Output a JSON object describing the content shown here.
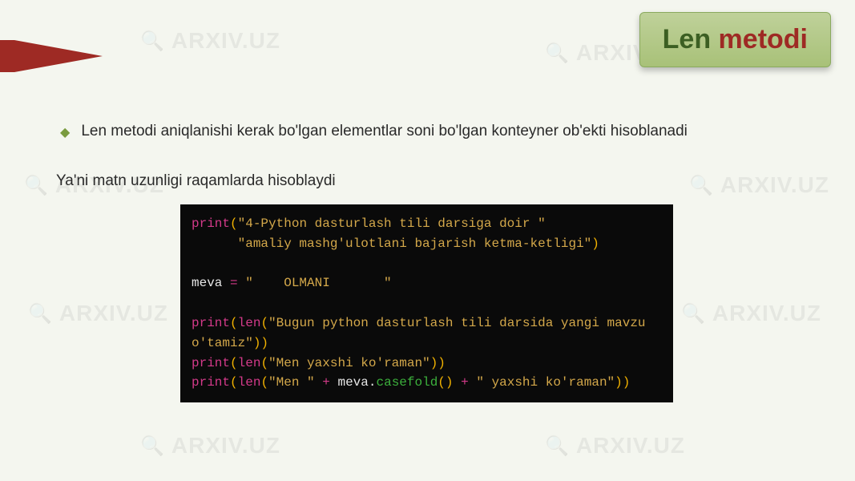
{
  "watermark_text": "ARXIV.UZ",
  "title": {
    "word1": "Len",
    "word2": "metodi"
  },
  "bullet": {
    "text": "Len metodi  aniqlanishi kerak bo'lgan elementlar soni bo'lgan konteyner ob'ekti hisoblanadi"
  },
  "subtext": "Ya'ni matn uzunligi raqamlarda hisoblaydi",
  "code": {
    "kw_print": "print",
    "kw_len": "len",
    "paren_open": "(",
    "paren_close": ")",
    "str1a": "\"4-Python dasturlash tili darsiga doir \"",
    "str1b": "\"amaliy mashg'ulotlani bajarish ketma-ketligi\"",
    "indent": "      ",
    "var_meva": "meva",
    "eq": " = ",
    "str_meva": "\"    OLMANI       \"",
    "str2": "\"Bugun python dasturlash tili darsida yangi mavzu o'tamiz\"",
    "str2_a": "\"Bugun python dasturlash tili darsida yangi mavzu ",
    "str2_b": "o'tamiz\"",
    "str3": "\"Men yaxshi ko'raman\"",
    "str4a": "\"Men \"",
    "plus": " + ",
    "dot": ".",
    "method": "casefold",
    "empty_paren": "()",
    "str4b": "\" yaxshi ko'raman\""
  }
}
